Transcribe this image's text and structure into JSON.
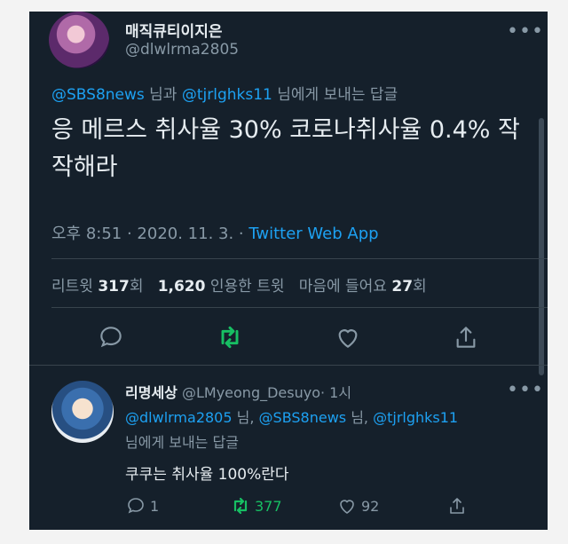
{
  "tweet": {
    "display_name": "매직큐티이지은",
    "handle": "@dlwlrma2805",
    "reply_to": {
      "user1": "@SBS8news",
      "mid": " 님과 ",
      "user2": "@tjrlghks11",
      "suffix": " 님에게 보내는 답글"
    },
    "text": "응 메르스 취사율 30% 코로나취사율 0.4% 작작해라",
    "time": "오후 8:51 · 2020. 11. 3. · ",
    "source": "Twitter Web App",
    "stats": {
      "retweets_label": "리트윗",
      "retweets": "317",
      "retweets_unit": "회",
      "quotes": "1,620",
      "quotes_label": " 인용한 트윗",
      "likes_label": "마음에 들어요",
      "likes": "27",
      "likes_unit": "회"
    }
  },
  "reply": {
    "display_name": "리명세상",
    "handle": "@LMyeong_Desuyo",
    "time": "· 1시",
    "reply_to": {
      "user1": "@dlwlrma2805",
      "sep1": " 님, ",
      "user2": "@SBS8news",
      "sep2": " 님, ",
      "user3": "@tjrlghks11",
      "suffix": "님에게 보내는 답글"
    },
    "text": "쿠쿠는 취사율 100%란다",
    "counts": {
      "replies": "1",
      "retweets": "377",
      "likes": "92"
    }
  },
  "more_icon": "•••",
  "colors": {
    "bg": "#15202b",
    "link": "#1da1f2",
    "retweet": "#17bf63",
    "muted": "#8899a6"
  }
}
